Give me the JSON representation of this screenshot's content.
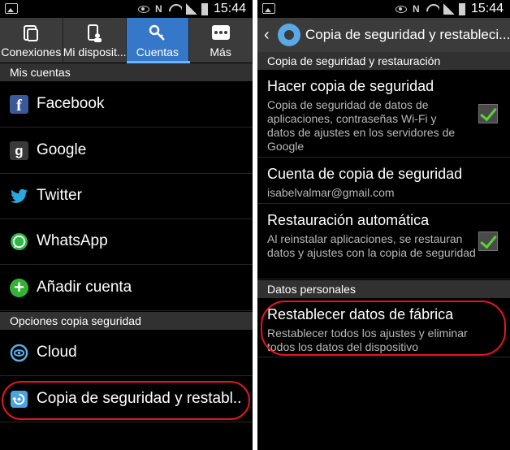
{
  "status": {
    "time": "15:44"
  },
  "left": {
    "tabs": [
      {
        "label": "Conexiones",
        "icon": "connections-icon"
      },
      {
        "label": "Mi disposit...",
        "icon": "device-icon"
      },
      {
        "label": "Cuentas",
        "icon": "key-icon",
        "active": true
      },
      {
        "label": "Más",
        "icon": "more-dots-icon"
      }
    ],
    "sections": {
      "accounts": "Mis cuentas",
      "backup": "Opciones copia seguridad"
    },
    "accounts": [
      {
        "label": "Facebook",
        "icon": "facebook-icon"
      },
      {
        "label": "Google",
        "icon": "google-icon"
      },
      {
        "label": "Twitter",
        "icon": "twitter-icon"
      },
      {
        "label": "WhatsApp",
        "icon": "whatsapp-icon"
      },
      {
        "label": "Añadir cuenta",
        "icon": "add-icon"
      }
    ],
    "backup": [
      {
        "label": "Cloud",
        "icon": "cloud-icon"
      },
      {
        "label": "Copia de seguridad y restabl..",
        "icon": "backup-icon"
      }
    ]
  },
  "right": {
    "title": "Copia de seguridad y restableci...",
    "sections": {
      "backup": "Copia de seguridad y restauración",
      "personal": "Datos personales"
    },
    "settings": [
      {
        "title": "Hacer copia de seguridad",
        "subtitle": "Copia de seguridad de datos de aplicaciones, contraseñas Wi-Fi y datos de ajustes en los servidores de Google",
        "checked": true
      },
      {
        "title": "Cuenta de copia de seguridad",
        "subtitle": "isabelvalmar@gmail.com"
      },
      {
        "title": "Restauración automática",
        "subtitle": "Al reinstalar aplicaciones, se restauran datos y ajustes con la copia de seguridad",
        "checked": true
      }
    ],
    "factory": {
      "title": "Restablecer datos de fábrica",
      "subtitle": "Restablecer todos los ajustes y eliminar todos los datos del dispositivo"
    }
  },
  "colors": {
    "accent": "#3577c8",
    "highlight_oval": "#e8141e",
    "check": "#5bd33a"
  }
}
